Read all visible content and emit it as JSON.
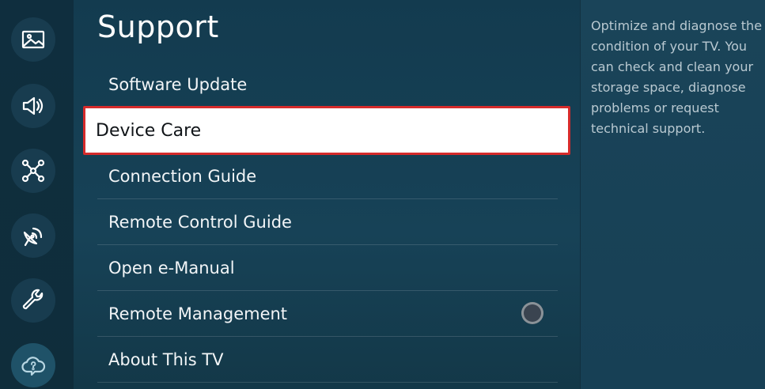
{
  "sidebar": {
    "items": [
      {
        "icon": "picture-icon"
      },
      {
        "icon": "sound-icon"
      },
      {
        "icon": "connection-icon"
      },
      {
        "icon": "broadcasting-icon"
      },
      {
        "icon": "wrench-icon"
      },
      {
        "icon": "support-cloud-icon",
        "active": true
      }
    ]
  },
  "menu": {
    "title": "Support",
    "items": [
      {
        "label": "Software Update"
      },
      {
        "label": "Device Care",
        "focused": true
      },
      {
        "label": "Connection Guide"
      },
      {
        "label": "Remote Control Guide"
      },
      {
        "label": "Open e-Manual"
      },
      {
        "label": "Remote Management",
        "toggle": "off"
      },
      {
        "label": "About This TV"
      }
    ]
  },
  "description": {
    "text": "Optimize and diagnose the condition of your TV. You can check and clean your storage space, diagnose problems or request technical support."
  },
  "colors": {
    "focus_border": "#d62b2b",
    "background": "#163f55"
  }
}
